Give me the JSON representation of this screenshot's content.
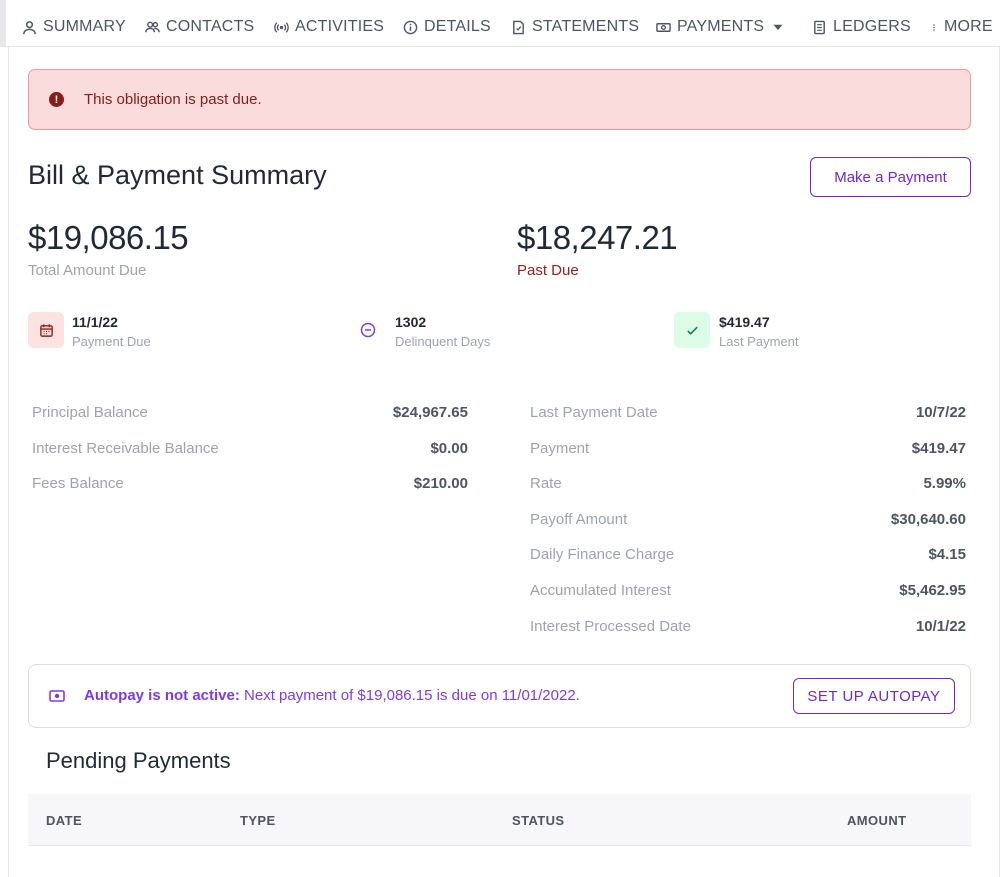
{
  "nav": {
    "items": [
      {
        "label": "SUMMARY",
        "icon": "person-icon"
      },
      {
        "label": "CONTACTS",
        "icon": "people-icon"
      },
      {
        "label": "ACTIVITIES",
        "icon": "broadcast-icon"
      },
      {
        "label": "DETAILS",
        "icon": "info-icon"
      },
      {
        "label": "STATEMENTS",
        "icon": "document-icon"
      },
      {
        "label": "PAYMENTS",
        "icon": "money-icon"
      },
      {
        "label": "LEDGERS",
        "icon": "ledger-icon"
      },
      {
        "label": "MORE",
        "icon": "kebab-icon"
      }
    ]
  },
  "alert": {
    "message": "This obligation is past due.",
    "color": "#fadcdc"
  },
  "summary": {
    "title": "Bill & Payment Summary",
    "make_payment_label": "Make a Payment",
    "total_amount": "$19,086.15",
    "total_label": "Total Amount Due",
    "past_due_amount": "$18,247.21",
    "past_due_label": "Past Due"
  },
  "stats": {
    "payment_due": {
      "value": "11/1/22",
      "label": "Payment Due",
      "icon": "calendar-icon"
    },
    "delinquent": {
      "value": "1302",
      "label": "Delinquent Days",
      "icon": "minus-circle-icon"
    },
    "last_payment": {
      "value": "$419.47",
      "label": "Last Payment",
      "icon": "check-icon"
    }
  },
  "balances_left": [
    {
      "label": "Principal Balance",
      "value": "$24,967.65"
    },
    {
      "label": "Interest Receivable Balance",
      "value": "$0.00"
    },
    {
      "label": "Fees Balance",
      "value": "$210.00"
    }
  ],
  "balances_right": [
    {
      "label": "Last Payment Date",
      "value": "10/7/22"
    },
    {
      "label": "Payment",
      "value": "$419.47"
    },
    {
      "label": "Rate",
      "value": "5.99%"
    },
    {
      "label": "Payoff Amount",
      "value": "$30,640.60"
    },
    {
      "label": "Daily Finance Charge",
      "value": "$4.15"
    },
    {
      "label": "Accumulated Interest",
      "value": "$5,462.95"
    },
    {
      "label": "Interest Processed Date",
      "value": "10/1/22"
    }
  ],
  "autopay": {
    "status": "Autopay is not active:",
    "message": " Next payment of $19,086.15 is due on 11/01/2022.",
    "button_label": "SET UP AUTOPAY"
  },
  "pending": {
    "title": "Pending Payments",
    "columns": [
      "DATE",
      "TYPE",
      "STATUS",
      "AMOUNT"
    ]
  },
  "colors": {
    "accent": "#6d28d9",
    "danger": "#991b1b",
    "success_bg": "#dcfce7"
  }
}
